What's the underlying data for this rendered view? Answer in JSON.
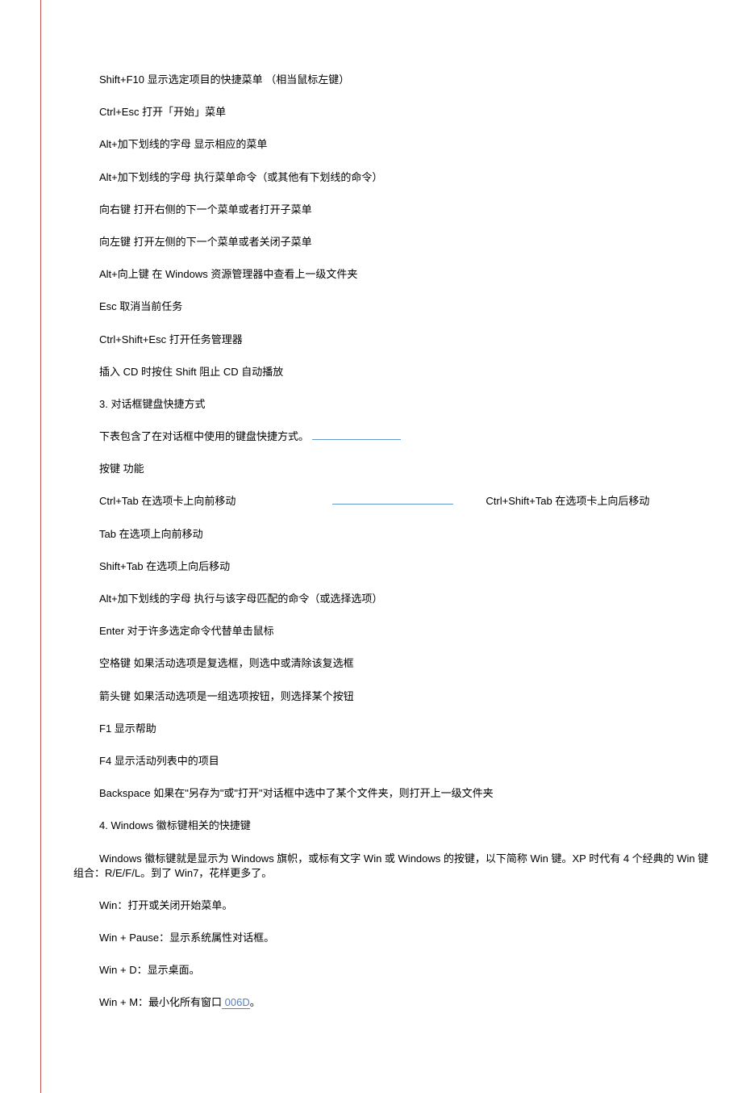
{
  "lines": {
    "l1": "Shift+F10  显示选定项目的快捷菜单    （相当鼠标左键）",
    "l2": "Ctrl+Esc  打开「开始」菜单",
    "l3": "Alt+加下划线的字母  显示相应的菜单",
    "l4": "Alt+加下划线的字母  执行菜单命令（或其他有下划线的命令）",
    "l5": "向右键  打开右侧的下一个菜单或者打开子菜单",
    "l6": "向左键  打开左侧的下一个菜单或者关闭子菜单",
    "l7": "Alt+向上键  在 Windows  资源管理器中查看上一级文件夹",
    "l8": "Esc  取消当前任务",
    "l9": "Ctrl+Shift+Esc  打开任务管理器",
    "l10": "插入 CD 时按住 Shift 阻止 CD 自动播放",
    "l11": "3.  对话框键盘快捷方式",
    "l12a": "下表包含了在对话框中使用的键盘快捷方式。",
    "l13": "按键  功能",
    "l14a": "Ctrl+Tab  在选项卡上向前移动",
    "l14b": "Ctrl+Shift+Tab  在选项卡上向后移动",
    "l15": "Tab  在选项上向前移动",
    "l16": "Shift+Tab  在选项上向后移动",
    "l17": "Alt+加下划线的字母  执行与该字母匹配的命令（或选择选项）",
    "l18": "Enter  对于许多选定命令代替单击鼠标",
    "l19": "空格键  如果活动选项是复选框，则选中或清除该复选框",
    "l20": "箭头键  如果活动选项是一组选项按钮，则选择某个按钮",
    "l21": "F1  显示帮助",
    "l22": "F4  显示活动列表中的项目",
    "l23": "Backspace  如果在\"另存为\"或\"打开\"对话框中选中了某个文件夹，则打开上一级文件夹",
    "l24": "4. Windows  徽标键相关的快捷键",
    "l25": "Windows 徽标键就是显示为 Windows 旗帜，或标有文字 Win 或 Windows 的按键，以下简称 Win 键。XP 时代有 4 个经典的  Win 键组合：R/E/F/L。到了 Win7，花样更多了。",
    "l26": "Win：打开或关闭开始菜单。",
    "l27": "Win + Pause：显示系统属性对话框。",
    "l28": "Win + D：显示桌面。",
    "l29a": "Win + M：最小化所有窗口",
    "l29b": "  006D",
    "l29c": "。"
  }
}
